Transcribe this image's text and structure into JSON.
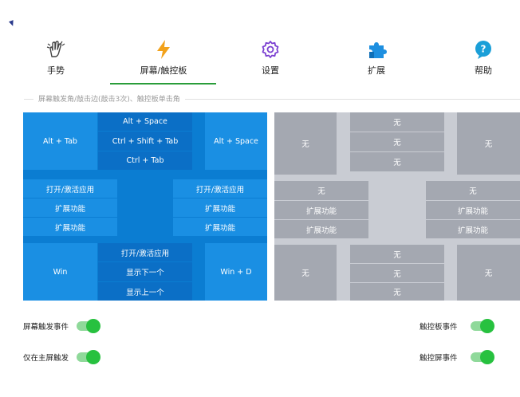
{
  "tabs": [
    {
      "label": "手势",
      "icon": "hand-gesture-icon"
    },
    {
      "label": "屏幕/触控板",
      "icon": "lightning-icon",
      "selected": true
    },
    {
      "label": "设置",
      "icon": "gear-icon"
    },
    {
      "label": "扩展",
      "icon": "puzzle-icon"
    },
    {
      "label": "帮助",
      "icon": "help-bubble-icon"
    }
  ],
  "section_caption": "屏幕触发角/敲击边(敲击3次)、触控板单击角",
  "screen_grid": {
    "top_left": "Alt + Tab",
    "top_middle": [
      "Alt + Space",
      "Ctrl + Shift + Tab",
      "Ctrl + Tab"
    ],
    "top_right": "Alt + Space",
    "middle_left": [
      "打开/激活应用",
      "扩展功能",
      "扩展功能"
    ],
    "middle_right": [
      "打开/激活应用",
      "扩展功能",
      "扩展功能"
    ],
    "bottom_left": "Win",
    "bottom_middle": [
      "打开/激活应用",
      "显示下一个",
      "显示上一个"
    ],
    "bottom_right": "Win + D"
  },
  "touchpad_grid": {
    "top_left": "无",
    "top_middle": [
      "无",
      "无",
      "无"
    ],
    "top_right": "无",
    "middle_left": [
      "无",
      "扩展功能",
      "扩展功能"
    ],
    "middle_right": [
      "无",
      "扩展功能",
      "扩展功能"
    ],
    "bottom_left": "无",
    "bottom_middle": [
      "无",
      "无",
      "无"
    ],
    "bottom_right": "无"
  },
  "toggles": {
    "screen_trigger_events": {
      "label": "屏幕触发事件",
      "on": true
    },
    "main_screen_only": {
      "label": "仅在主屏触发",
      "on": true
    },
    "touchpad_events": {
      "label": "触控板事件",
      "on": true
    },
    "touchscreen_events": {
      "label": "触控屏事件",
      "on": true
    }
  },
  "colors": {
    "accent_green": "#27c13f",
    "active_blue": "#1a8fe3",
    "inactive_gray": "#a4a8b1"
  }
}
